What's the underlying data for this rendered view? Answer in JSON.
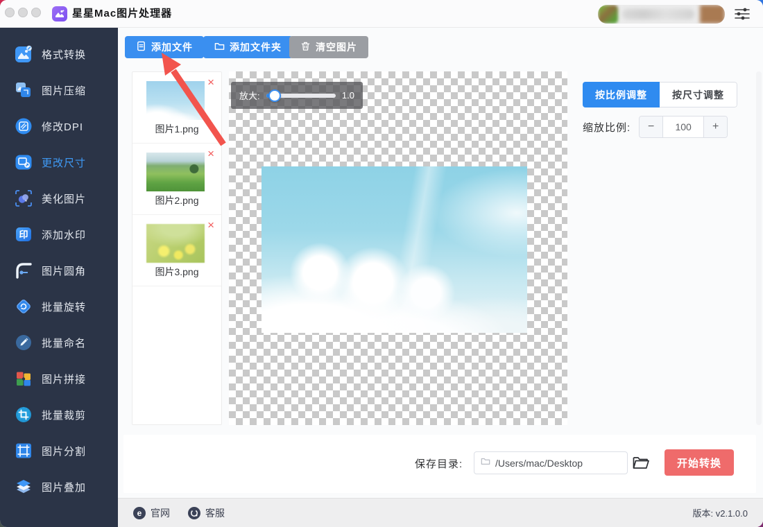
{
  "window": {
    "title": "星星Mac图片处理器"
  },
  "sidebar": {
    "items": [
      {
        "label": "格式转换",
        "active": false
      },
      {
        "label": "图片压缩",
        "active": false
      },
      {
        "label": "修改DPI",
        "active": false
      },
      {
        "label": "更改尺寸",
        "active": true
      },
      {
        "label": "美化图片",
        "active": false
      },
      {
        "label": "添加水印",
        "active": false
      },
      {
        "label": "图片圆角",
        "active": false
      },
      {
        "label": "批量旋转",
        "active": false
      },
      {
        "label": "批量命名",
        "active": false
      },
      {
        "label": "图片拼接",
        "active": false
      },
      {
        "label": "批量裁剪",
        "active": false
      },
      {
        "label": "图片分割",
        "active": false
      },
      {
        "label": "图片叠加",
        "active": false
      }
    ]
  },
  "toolbar": {
    "add_file": "添加文件",
    "add_folder": "添加文件夹",
    "clear": "清空图片"
  },
  "files": [
    {
      "name": "图片1.png",
      "delete": "×"
    },
    {
      "name": "图片2.png",
      "delete": "×"
    },
    {
      "name": "图片3.png",
      "delete": "×"
    }
  ],
  "preview": {
    "zoom_label": "放大:",
    "zoom_value": "1.0"
  },
  "right_panel": {
    "tab_ratio": "按比例调整",
    "tab_size": "按尺寸调整",
    "scale_label": "缩放比例:",
    "scale_value": "100",
    "minus": "−",
    "plus": "+"
  },
  "bottom_bar": {
    "save_label": "保存目录:",
    "path": "/Users/mac/Desktop",
    "start": "开始转换"
  },
  "footer": {
    "official": "官网",
    "support": "客服",
    "version_label": "版本:",
    "version": "v2.1.0.0"
  },
  "icons": {
    "watermark_glyph": "印",
    "official_glyph": "e"
  },
  "colors": {
    "accent_blue": "#2f8bf0",
    "sidebar_bg": "#2b3447",
    "danger_red": "#ef6b6b",
    "delete_x": "#f25c5c",
    "arrow_red": "#f2544d"
  }
}
